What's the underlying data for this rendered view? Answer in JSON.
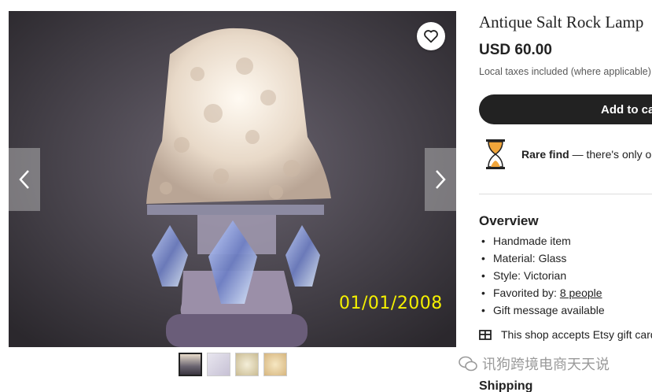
{
  "listing": {
    "title": "Antique Salt Rock Lamp",
    "price": "USD 60.00",
    "tax_note": "Local taxes included (where applicable)",
    "add_to_cart": "Add to cart"
  },
  "image": {
    "date_stamp": "01/01/2008",
    "thumbnails": [
      "thumb-1",
      "thumb-2",
      "thumb-3",
      "thumb-4"
    ],
    "active_thumbnail": 1
  },
  "rare_find": {
    "label": "Rare find",
    "text": " — there's only one of this in stock."
  },
  "overview": {
    "heading": "Overview",
    "items": [
      {
        "text": "Handmade item"
      },
      {
        "text": "Material: Glass"
      },
      {
        "text": "Style: Victorian"
      },
      {
        "prefix": "Favorited by: ",
        "link": "8 people"
      },
      {
        "text": "Gift message available"
      }
    ]
  },
  "gift_card": "This shop accepts Etsy gift cards",
  "shipping_heading": "Shipping",
  "watermark": "讯狗跨境电商天天说",
  "colors": {
    "accent": "#222222",
    "stamp": "#f4f000",
    "hourglass": "#f1a53a"
  }
}
